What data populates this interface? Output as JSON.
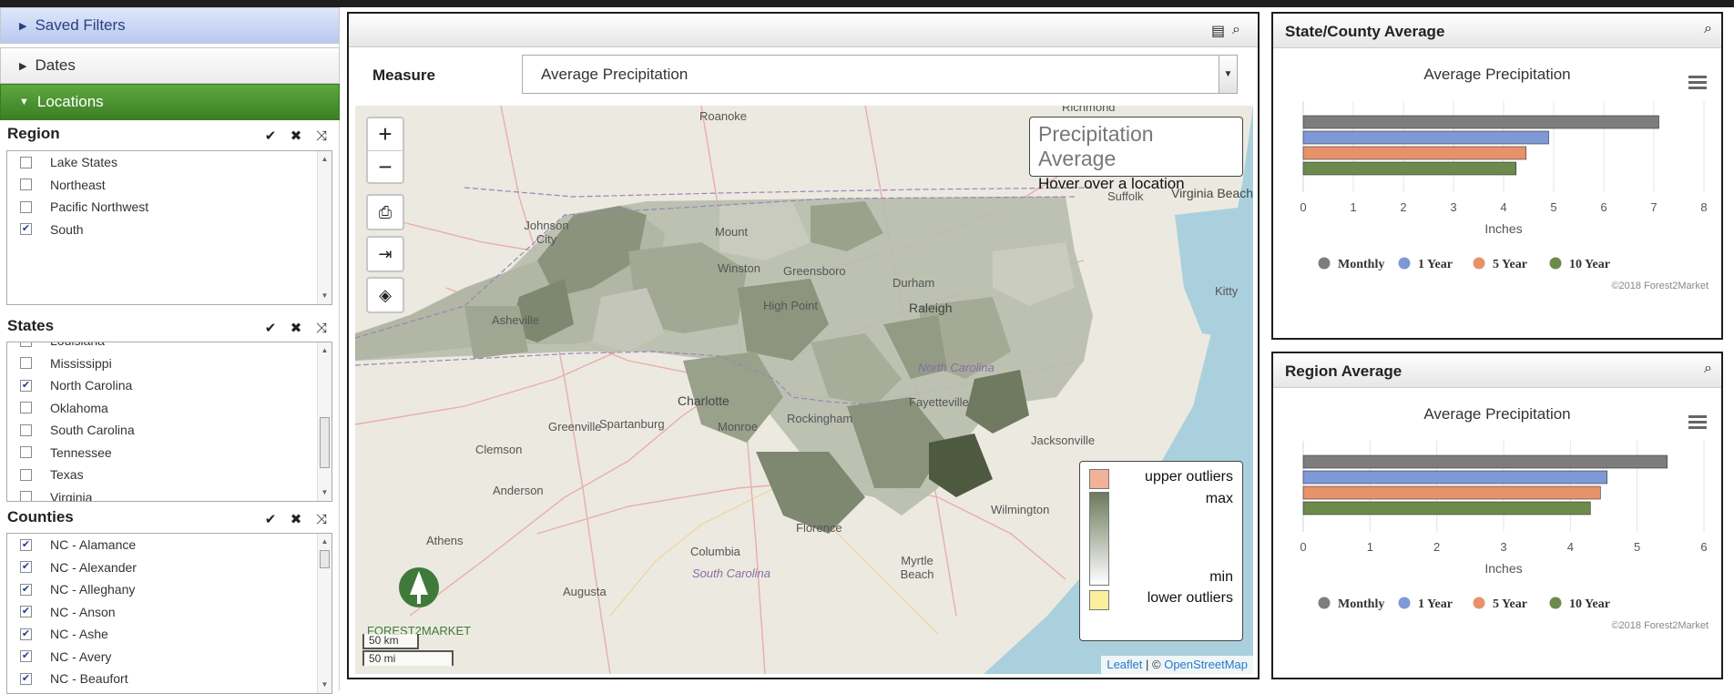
{
  "sidebar": {
    "saved_filters": "Saved Filters",
    "dates": "Dates",
    "locations": "Locations",
    "region": {
      "title": "Region",
      "items": [
        {
          "label": "Lake States",
          "checked": false
        },
        {
          "label": "Northeast",
          "checked": false
        },
        {
          "label": "Pacific Northwest",
          "checked": false
        },
        {
          "label": "South",
          "checked": true
        }
      ]
    },
    "states": {
      "title": "States",
      "items": [
        {
          "label": "Louisiana",
          "checked": false
        },
        {
          "label": "Mississippi",
          "checked": false
        },
        {
          "label": "North Carolina",
          "checked": true
        },
        {
          "label": "Oklahoma",
          "checked": false
        },
        {
          "label": "South Carolina",
          "checked": false
        },
        {
          "label": "Tennessee",
          "checked": false
        },
        {
          "label": "Texas",
          "checked": false
        },
        {
          "label": "Virginia",
          "checked": false
        }
      ]
    },
    "counties": {
      "title": "Counties",
      "items": [
        {
          "label": "NC - Alamance",
          "checked": true
        },
        {
          "label": "NC - Alexander",
          "checked": true
        },
        {
          "label": "NC - Alleghany",
          "checked": true
        },
        {
          "label": "NC - Anson",
          "checked": true
        },
        {
          "label": "NC - Ashe",
          "checked": true
        },
        {
          "label": "NC - Avery",
          "checked": true
        },
        {
          "label": "NC - Beaufort",
          "checked": true
        }
      ]
    }
  },
  "map_panel": {
    "measure_label": "Measure",
    "measure_value": "Average Precipitation",
    "info": {
      "title": "Precipitation Average",
      "subtitle": "Hover over a location"
    },
    "legend": {
      "upper": "upper outliers",
      "max": "max",
      "min": "min",
      "lower": "lower outliers",
      "upper_color": "#f2b29a",
      "lower_color": "#fbef9c",
      "max_color": "#6c7a5c",
      "min_color": "#ffffff"
    },
    "scale": {
      "km": "50 km",
      "mi": "50 mi"
    },
    "attribution": {
      "leaflet": "Leaflet",
      "sep": "| ©",
      "osm": "OpenStreetMap"
    },
    "logo_text": "FOREST2MARKET",
    "places": [
      "Roanoke",
      "Richmond",
      "Johnson City",
      "Mount",
      "Winston",
      "Greensboro",
      "High Point",
      "Durham",
      "Raleigh",
      "Suffolk",
      "Virginia Beach",
      "Kitty",
      "Asheville",
      "Charlotte",
      "Fayetteville",
      "North Carolina",
      "Greenville",
      "Spartanburg",
      "Monroe",
      "Rockingham",
      "Jacksonville",
      "Clemson",
      "Anderson",
      "Athens",
      "Florence",
      "Columbia",
      "South Carolina",
      "Augusta",
      "Myrtle Beach",
      "Wilmington"
    ]
  },
  "state_chart": {
    "header": "State/County Average",
    "chart_data": {
      "type": "bar",
      "title": "Average Precipitation",
      "xlabel": "Inches",
      "xlim": [
        0,
        8
      ],
      "ticks": [
        "0",
        "1",
        "2",
        "3",
        "4",
        "5",
        "6",
        "7",
        "8"
      ],
      "series": [
        {
          "name": "Monthly",
          "value": 7.1,
          "color": "#7d7d7d"
        },
        {
          "name": "1 Year",
          "value": 4.9,
          "color": "#7f98d6"
        },
        {
          "name": "5 Year",
          "value": 4.45,
          "color": "#e8926a"
        },
        {
          "name": "10 Year",
          "value": 4.25,
          "color": "#6c8a4c"
        }
      ]
    },
    "credit": "©2018 Forest2Market"
  },
  "region_chart": {
    "header": "Region Average",
    "chart_data": {
      "type": "bar",
      "title": "Average Precipitation",
      "xlabel": "Inches",
      "xlim": [
        0,
        6
      ],
      "ticks": [
        "0",
        "1",
        "2",
        "3",
        "4",
        "5",
        "6"
      ],
      "series": [
        {
          "name": "Monthly",
          "value": 5.45,
          "color": "#7d7d7d"
        },
        {
          "name": "1 Year",
          "value": 4.55,
          "color": "#7f98d6"
        },
        {
          "name": "5 Year",
          "value": 4.45,
          "color": "#e8926a"
        },
        {
          "name": "10 Year",
          "value": 4.3,
          "color": "#6c8a4c"
        }
      ]
    },
    "credit": "©2018 Forest2Market"
  }
}
